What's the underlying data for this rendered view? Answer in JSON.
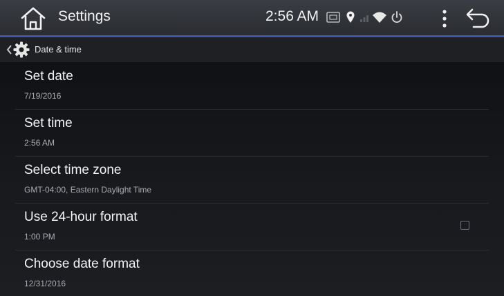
{
  "header": {
    "title": "Settings",
    "time": "2:56 AM",
    "icons": [
      "home-icon",
      "sd-card-icon",
      "location-icon",
      "signal-icon",
      "wifi-icon",
      "power-icon",
      "overflow-menu-icon",
      "back-arrow-icon"
    ]
  },
  "breadcrumb": {
    "label": "Date & time",
    "icon": "gear-icon"
  },
  "settings": {
    "items": [
      {
        "title": "Set date",
        "value": "7/19/2016"
      },
      {
        "title": "Set time",
        "value": "2:56 AM"
      },
      {
        "title": "Select time zone",
        "value": "GMT-04:00, Eastern Daylight Time"
      },
      {
        "title": "Use 24-hour format",
        "value": "1:00 PM",
        "checked": false
      },
      {
        "title": "Choose date format",
        "value": "12/31/2016"
      }
    ]
  },
  "colors": {
    "accent": "#3b57b4",
    "background": "#17191d",
    "text": "#f4f4f4",
    "subtext": "#a9abb0"
  }
}
